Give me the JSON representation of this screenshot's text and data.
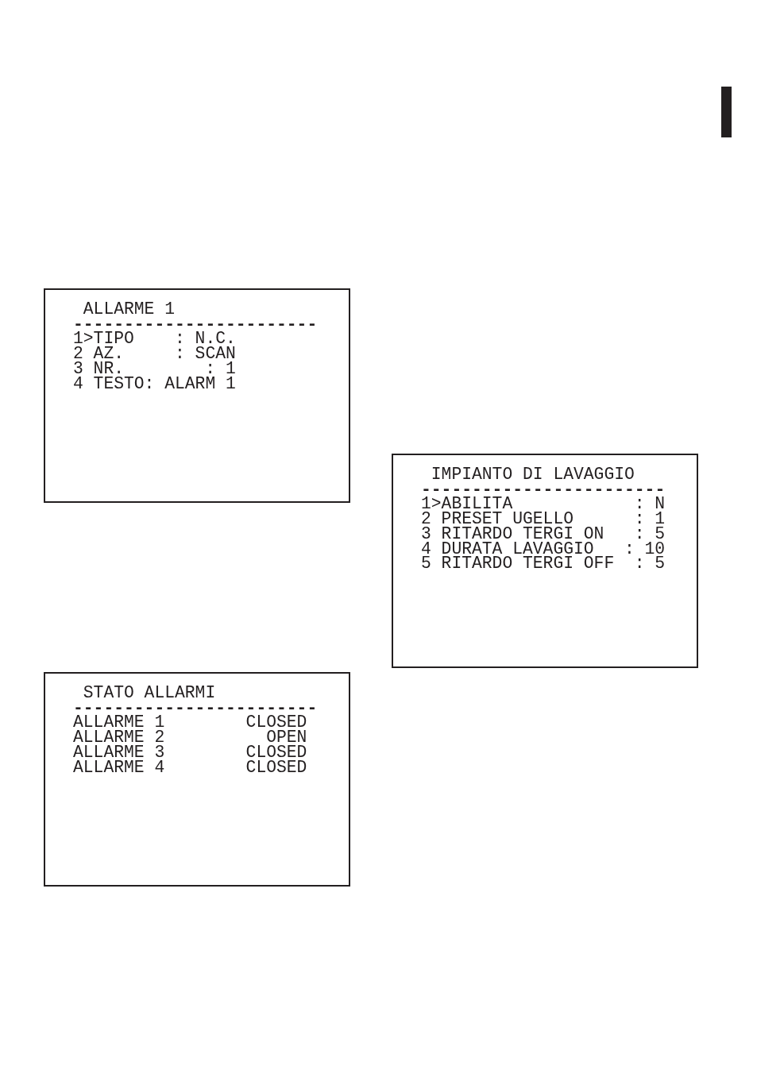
{
  "left_column": {
    "screens": [
      {
        "kind": "settings",
        "title": "ALLARME 1",
        "divider": "------------------------",
        "rows": [
          {
            "label": "1>TIPO",
            "separator": ":",
            "value": "N.C."
          },
          {
            "label": "2 AZ.",
            "separator": ":",
            "value": "SCAN"
          },
          {
            "label": "3 NR.",
            "separator": ":",
            "value": "1"
          },
          {
            "label": "4 TESTO",
            "separator": ":",
            "value": "ALARM 1"
          }
        ]
      },
      {
        "kind": "status",
        "title": "STATO ALLARMI",
        "divider": "------------------------",
        "rows": [
          {
            "label": "ALLARME 1",
            "value": "CLOSED"
          },
          {
            "label": "ALLARME 2",
            "value": "OPEN"
          },
          {
            "label": "ALLARME 3",
            "value": "CLOSED"
          },
          {
            "label": "ALLARME 4",
            "value": "CLOSED"
          }
        ]
      }
    ]
  },
  "right_column": {
    "screens": [
      {
        "kind": "settings",
        "title": "IMPIANTO DI LAVAGGIO",
        "divider": "------------------------",
        "rows": [
          {
            "label": "1>ABILITA",
            "separator": ":",
            "value": "N"
          },
          {
            "label": "2 PRESET UGELLO",
            "separator": ":",
            "value": "1"
          },
          {
            "label": "3 RITARDO TERGI ON",
            "separator": ":",
            "value": "5"
          },
          {
            "label": "4 DURATA LAVAGGIO",
            "separator": ":",
            "value": "10"
          },
          {
            "label": "5 RITARDO TERGI OFF",
            "separator": ":",
            "value": "5"
          }
        ]
      }
    ]
  }
}
